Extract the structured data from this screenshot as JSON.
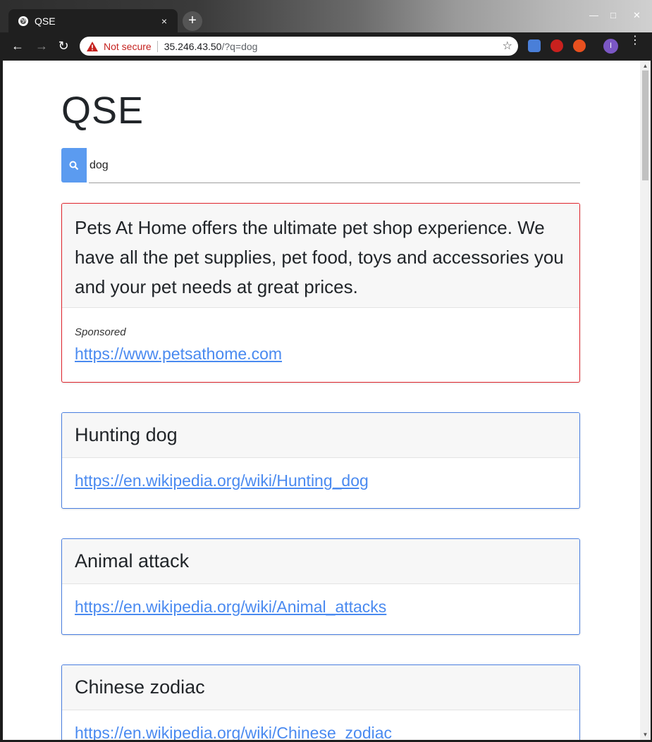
{
  "browser": {
    "tab_title": "QSE",
    "tab_close": "×",
    "new_tab": "+",
    "security_label": "Not secure",
    "url_host": "35.246.43.50",
    "url_path": "/?q=dog",
    "profile_initial": "I"
  },
  "page": {
    "logo": "QSE",
    "search_query": "dog",
    "ad": {
      "text": "Pets At Home offers the ultimate pet shop experience. We have all the pet supplies, pet food, toys and accessories you and your pet needs at great prices.",
      "sponsored_label": "Sponsored",
      "url": "https://www.petsathome.com"
    },
    "results": [
      {
        "title": "Hunting dog",
        "url": "https://en.wikipedia.org/wiki/Hunting_dog"
      },
      {
        "title": "Animal attack",
        "url": "https://en.wikipedia.org/wiki/Animal_attacks"
      },
      {
        "title": "Chinese zodiac",
        "url": "https://en.wikipedia.org/wiki/Chinese_zodiac"
      }
    ]
  },
  "colors": {
    "ad_border": "#e0242c",
    "result_border": "#4a7fe0",
    "link": "#4a8af0",
    "search_button": "#5b9bf0"
  }
}
